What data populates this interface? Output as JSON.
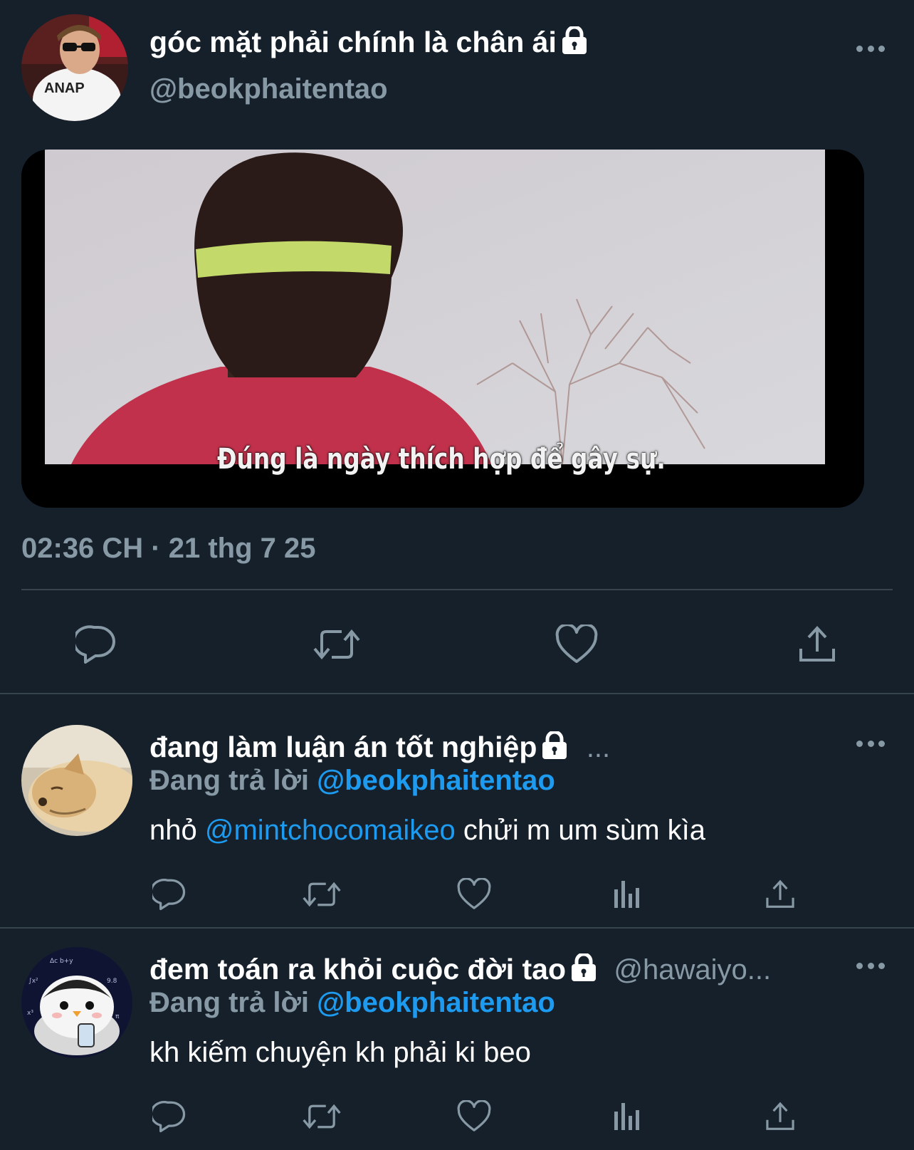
{
  "main_tweet": {
    "display_name": "góc mặt phải chính là chân ái",
    "handle": "@beokphaitentao",
    "media_caption": "Đúng là ngày thích hợp để gây sự.",
    "timestamp": "02:36 CH · 21 thg 7 25",
    "actions": [
      "reply-icon",
      "retweet-icon",
      "like-icon",
      "share-icon"
    ]
  },
  "replies": [
    {
      "display_name": "đang làm luận án tốt nghiệp",
      "handle_truncated": "...",
      "reply_prefix": "Đang trả lời",
      "reply_to": "@beokphaitentao",
      "text_before": "nhỏ",
      "text_mention": "@mintchocomaikeo",
      "text_after": "chửi m um sùm kìa"
    },
    {
      "display_name": "đem toán ra khỏi cuộc đời tao",
      "handle_truncated": "@hawaiyo...",
      "reply_prefix": "Đang trả lời",
      "reply_to": "@beokphaitentao",
      "text": "kh kiếm chuyện kh phải ki beo"
    }
  ],
  "colors": {
    "background": "#15202b",
    "accent": "#1d9bf0",
    "secondary_text": "#8899a6",
    "divider": "#38444d"
  }
}
